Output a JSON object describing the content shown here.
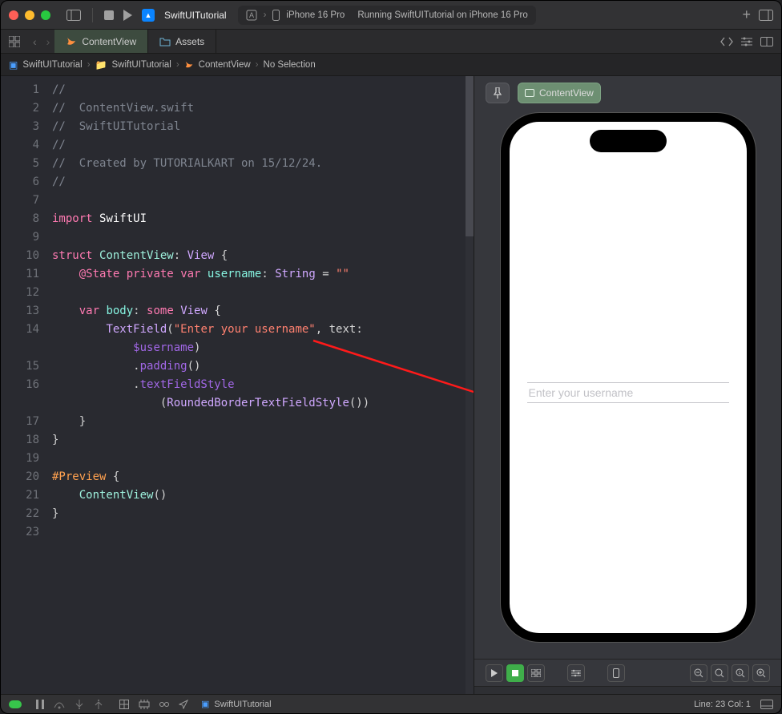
{
  "titlebar": {
    "project_name": "SwiftUITutorial",
    "scheme_app": "SwiftUITutorial",
    "device": "iPhone 16 Pro",
    "status": "Running SwiftUITutorial on iPhone 16 Pro"
  },
  "tabs": {
    "active": "ContentView",
    "assets": "Assets"
  },
  "breadcrumb": {
    "project": "SwiftUITutorial",
    "folder": "SwiftUITutorial",
    "file": "ContentView",
    "selection": "No Selection"
  },
  "editor": {
    "gutter": [
      "1",
      "2",
      "3",
      "4",
      "5",
      "6",
      "7",
      "8",
      "9",
      "10",
      "11",
      "12",
      "13",
      "14",
      "",
      "15",
      "16",
      "",
      "17",
      "18",
      "19",
      "20",
      "21",
      "22",
      "23"
    ],
    "lines": [
      [
        {
          "cls": "c-comment",
          "t": "//"
        }
      ],
      [
        {
          "cls": "c-comment",
          "t": "//  ContentView.swift"
        }
      ],
      [
        {
          "cls": "c-comment",
          "t": "//  SwiftUITutorial"
        }
      ],
      [
        {
          "cls": "c-comment",
          "t": "//"
        }
      ],
      [
        {
          "cls": "c-comment",
          "t": "//  Created by TUTORIALKART on 15/12/24."
        }
      ],
      [
        {
          "cls": "c-comment",
          "t": "//"
        }
      ],
      [
        {
          "cls": "",
          "t": ""
        }
      ],
      [
        {
          "cls": "c-kw",
          "t": "import"
        },
        {
          "cls": "",
          "t": " "
        },
        {
          "cls": "c-white",
          "t": "SwiftUI"
        }
      ],
      [
        {
          "cls": "",
          "t": ""
        }
      ],
      [
        {
          "cls": "c-kw",
          "t": "struct"
        },
        {
          "cls": "",
          "t": " "
        },
        {
          "cls": "c-typedef",
          "t": "ContentView"
        },
        {
          "cls": "",
          "t": ": "
        },
        {
          "cls": "c-type",
          "t": "View"
        },
        {
          "cls": "",
          "t": " {"
        }
      ],
      [
        {
          "cls": "",
          "t": "    "
        },
        {
          "cls": "c-kw",
          "t": "@State"
        },
        {
          "cls": "",
          "t": " "
        },
        {
          "cls": "c-kw",
          "t": "private"
        },
        {
          "cls": "",
          "t": " "
        },
        {
          "cls": "c-kw",
          "t": "var"
        },
        {
          "cls": "",
          "t": " "
        },
        {
          "cls": "c-prop",
          "t": "username"
        },
        {
          "cls": "",
          "t": ": "
        },
        {
          "cls": "c-type",
          "t": "String"
        },
        {
          "cls": "",
          "t": " = "
        },
        {
          "cls": "c-str",
          "t": "\"\""
        }
      ],
      [
        {
          "cls": "",
          "t": ""
        }
      ],
      [
        {
          "cls": "",
          "t": "    "
        },
        {
          "cls": "c-kw",
          "t": "var"
        },
        {
          "cls": "",
          "t": " "
        },
        {
          "cls": "c-prop",
          "t": "body"
        },
        {
          "cls": "",
          "t": ": "
        },
        {
          "cls": "c-kw",
          "t": "some"
        },
        {
          "cls": "",
          "t": " "
        },
        {
          "cls": "c-type",
          "t": "View"
        },
        {
          "cls": "",
          "t": " {"
        }
      ],
      [
        {
          "cls": "",
          "t": "        "
        },
        {
          "cls": "c-type",
          "t": "TextField"
        },
        {
          "cls": "",
          "t": "("
        },
        {
          "cls": "c-str",
          "t": "\"Enter your username\""
        },
        {
          "cls": "",
          "t": ", text:"
        }
      ],
      [
        {
          "cls": "",
          "t": "            "
        },
        {
          "cls": "c-func",
          "t": "$username"
        },
        {
          "cls": "",
          "t": ")"
        }
      ],
      [
        {
          "cls": "",
          "t": "            ."
        },
        {
          "cls": "c-func",
          "t": "padding"
        },
        {
          "cls": "",
          "t": "()"
        }
      ],
      [
        {
          "cls": "",
          "t": "            ."
        },
        {
          "cls": "c-func",
          "t": "textFieldStyle"
        }
      ],
      [
        {
          "cls": "",
          "t": "                ("
        },
        {
          "cls": "c-type",
          "t": "RoundedBorderTextFieldStyle"
        },
        {
          "cls": "",
          "t": "())"
        }
      ],
      [
        {
          "cls": "",
          "t": "    }"
        }
      ],
      [
        {
          "cls": "",
          "t": "}"
        }
      ],
      [
        {
          "cls": "",
          "t": ""
        }
      ],
      [
        {
          "cls": "c-preview",
          "t": "#Preview"
        },
        {
          "cls": "",
          "t": " {"
        }
      ],
      [
        {
          "cls": "",
          "t": "    "
        },
        {
          "cls": "c-typedef",
          "t": "ContentView"
        },
        {
          "cls": "",
          "t": "()"
        }
      ],
      [
        {
          "cls": "",
          "t": "}"
        }
      ],
      [
        {
          "cls": "",
          "t": ""
        }
      ]
    ]
  },
  "preview": {
    "chip": "ContentView",
    "placeholder": "Enter your username"
  },
  "statusbar": {
    "file": "SwiftUITutorial",
    "cursor": "Line: 23  Col: 1"
  }
}
